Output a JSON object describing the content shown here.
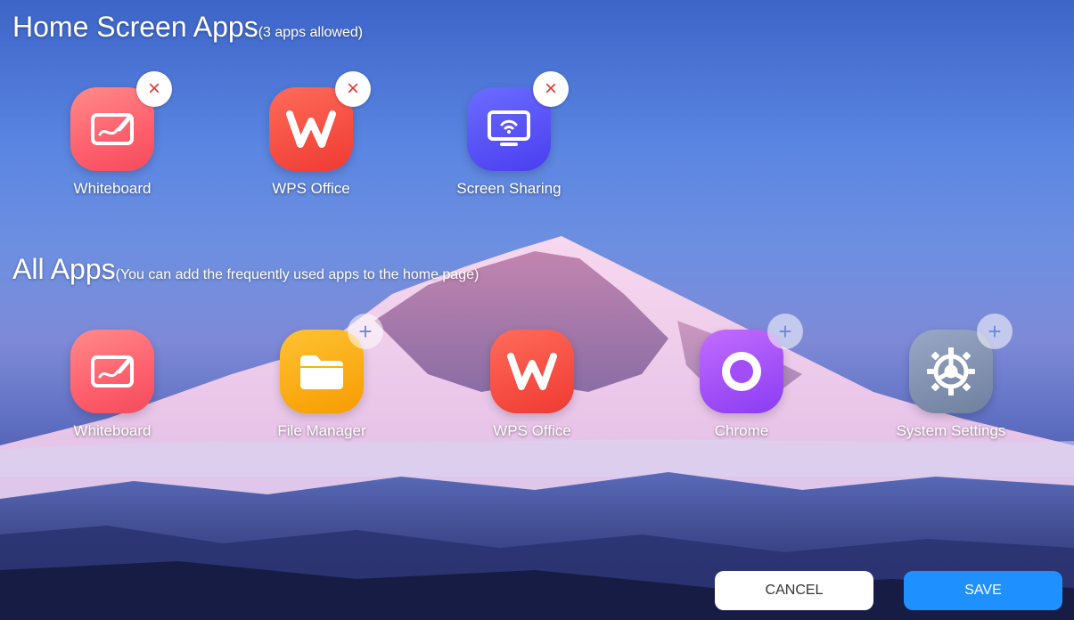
{
  "home_section": {
    "title": "Home Screen Apps",
    "subtitle": "(3 apps allowed)",
    "apps": [
      {
        "label": "Whiteboard",
        "icon": "whiteboard-icon",
        "action": "remove"
      },
      {
        "label": "WPS Office",
        "icon": "wps-office-icon",
        "action": "remove"
      },
      {
        "label": "Screen Sharing",
        "icon": "screen-sharing-icon",
        "action": "remove"
      }
    ],
    "remove_symbol": "×"
  },
  "all_section": {
    "title": "All Apps",
    "subtitle": "(You can add the frequently used apps to the home page)",
    "apps": [
      {
        "label": "Whiteboard",
        "icon": "whiteboard-icon",
        "action": "none"
      },
      {
        "label": "File Manager",
        "icon": "folder-icon",
        "action": "add"
      },
      {
        "label": "WPS Office",
        "icon": "wps-office-icon",
        "action": "none"
      },
      {
        "label": "Chrome",
        "icon": "chrome-icon",
        "action": "add"
      },
      {
        "label": "System Settings",
        "icon": "settings-gear-icon",
        "action": "add"
      }
    ],
    "add_symbol": "+"
  },
  "buttons": {
    "cancel": "CANCEL",
    "save": "SAVE"
  },
  "colors": {
    "save_button": "#1e90ff",
    "remove_badge": "#e53935"
  }
}
